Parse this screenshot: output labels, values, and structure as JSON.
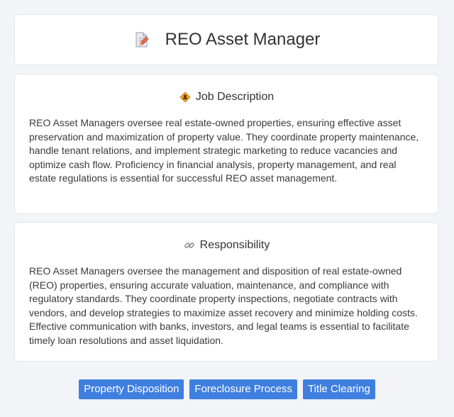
{
  "header": {
    "title": "REO Asset Manager",
    "icon": "document-pencil-icon"
  },
  "sections": [
    {
      "title": "Job Description",
      "icon": "worker-badge-icon",
      "text": "REO Asset Managers oversee real estate-owned properties, ensuring effective asset preservation and maximization of property value. They coordinate property maintenance, handle tenant relations, and implement strategic marketing to reduce vacancies and optimize cash flow. Proficiency in financial analysis, property management, and real estate regulations is essential for successful REO asset management."
    },
    {
      "title": "Responsibility",
      "icon": "link-icon",
      "text": "REO Asset Managers oversee the management and disposition of real estate-owned (REO) properties, ensuring accurate valuation, maintenance, and compliance with regulatory standards. They coordinate property inspections, negotiate contracts with vendors, and develop strategies to maximize asset recovery and minimize holding costs. Effective communication with banks, investors, and legal teams is essential to facilitate timely loan resolutions and asset liquidation."
    }
  ],
  "tags": [
    "Property Disposition",
    "Foreclosure Process",
    "Title Clearing"
  ],
  "colors": {
    "tag_background": "#3f7fe0",
    "page_background": "#f3f4f8"
  }
}
